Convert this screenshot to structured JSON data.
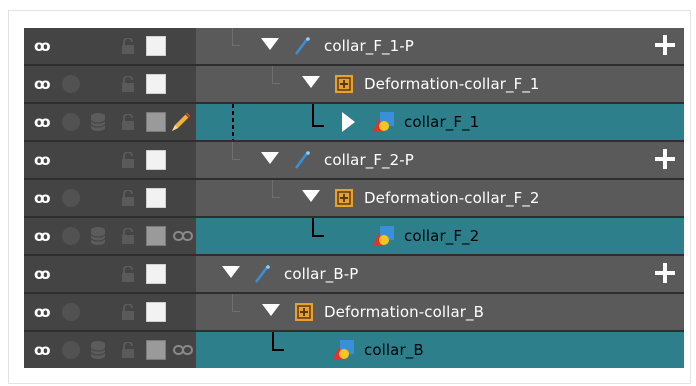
{
  "layers": [
    {
      "name": "collar_F_1-P",
      "type": "peg",
      "selected": false,
      "icons": "peg"
    },
    {
      "name": "Deformation-collar_F_1",
      "type": "deformation-group",
      "selected": false
    },
    {
      "name": "collar_F_1",
      "type": "drawing",
      "selected": true
    },
    {
      "name": "collar_F_2-P",
      "type": "peg",
      "selected": false
    },
    {
      "name": "Deformation-collar_F_2",
      "type": "deformation-group",
      "selected": false
    },
    {
      "name": "collar_F_2",
      "type": "drawing",
      "selected": true
    },
    {
      "name": "collar_B-P",
      "type": "peg",
      "selected": false
    },
    {
      "name": "Deformation-collar_B",
      "type": "deformation-group",
      "selected": false
    },
    {
      "name": "collar_B",
      "type": "drawing",
      "selected": true
    }
  ],
  "colors": {
    "selected_row": "#2d7f8b",
    "row_bg": "#5a5a5a",
    "left_col": "#444444",
    "deform_icon": "#e8a033",
    "peg_icon": "#3a8fd9"
  },
  "icons": {
    "visibility": "eye-icon",
    "lock": "lock-icon",
    "color": "color-swatch-icon",
    "edit": "pencil-icon",
    "link": "link-icon",
    "add": "plus-icon",
    "solo": "dot-icon",
    "stack": "database-icon"
  }
}
